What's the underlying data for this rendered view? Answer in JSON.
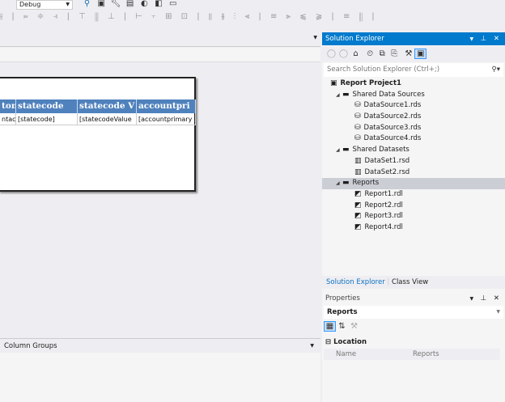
{
  "toolbar": {
    "config": "Debug"
  },
  "report": {
    "headers": [
      "ton",
      "statecode",
      "statecode V",
      "accountpri"
    ],
    "cells": [
      "ntact",
      "[statecode]",
      "[statecodeValue",
      "[accountprimary"
    ]
  },
  "bottom": {
    "column_groups": "Column Groups"
  },
  "solution_explorer": {
    "title": "Solution Explorer",
    "search_placeholder": "Search Solution Explorer (Ctrl+;)",
    "tree": [
      {
        "label": "Report Project1",
        "level": 0,
        "icon": "project"
      },
      {
        "label": "Shared Data Sources",
        "level": 1,
        "icon": "folder"
      },
      {
        "label": "DataSource1.rds",
        "level": 2,
        "icon": "datasource"
      },
      {
        "label": "DataSource2.rds",
        "level": 2,
        "icon": "datasource"
      },
      {
        "label": "DataSource3.rds",
        "level": 2,
        "icon": "datasource"
      },
      {
        "label": "DataSource4.rds",
        "level": 2,
        "icon": "datasource"
      },
      {
        "label": "Shared Datasets",
        "level": 1,
        "icon": "folder"
      },
      {
        "label": "DataSet1.rsd",
        "level": 2,
        "icon": "dataset"
      },
      {
        "label": "DataSet2.rsd",
        "level": 2,
        "icon": "dataset"
      },
      {
        "label": "Reports",
        "level": 1,
        "icon": "folder",
        "selected": true
      },
      {
        "label": "Report1.rdl",
        "level": 2,
        "icon": "report"
      },
      {
        "label": "Report2.rdl",
        "level": 2,
        "icon": "report"
      },
      {
        "label": "Report3.rdl",
        "level": 2,
        "icon": "report"
      },
      {
        "label": "Report4.rdl",
        "level": 2,
        "icon": "report"
      }
    ],
    "tabs": [
      "Solution Explorer",
      "Class View"
    ]
  },
  "properties": {
    "title": "Properties",
    "object": "Reports",
    "category": "Location",
    "rows": [
      {
        "name": "Name",
        "value": "Reports"
      }
    ]
  }
}
